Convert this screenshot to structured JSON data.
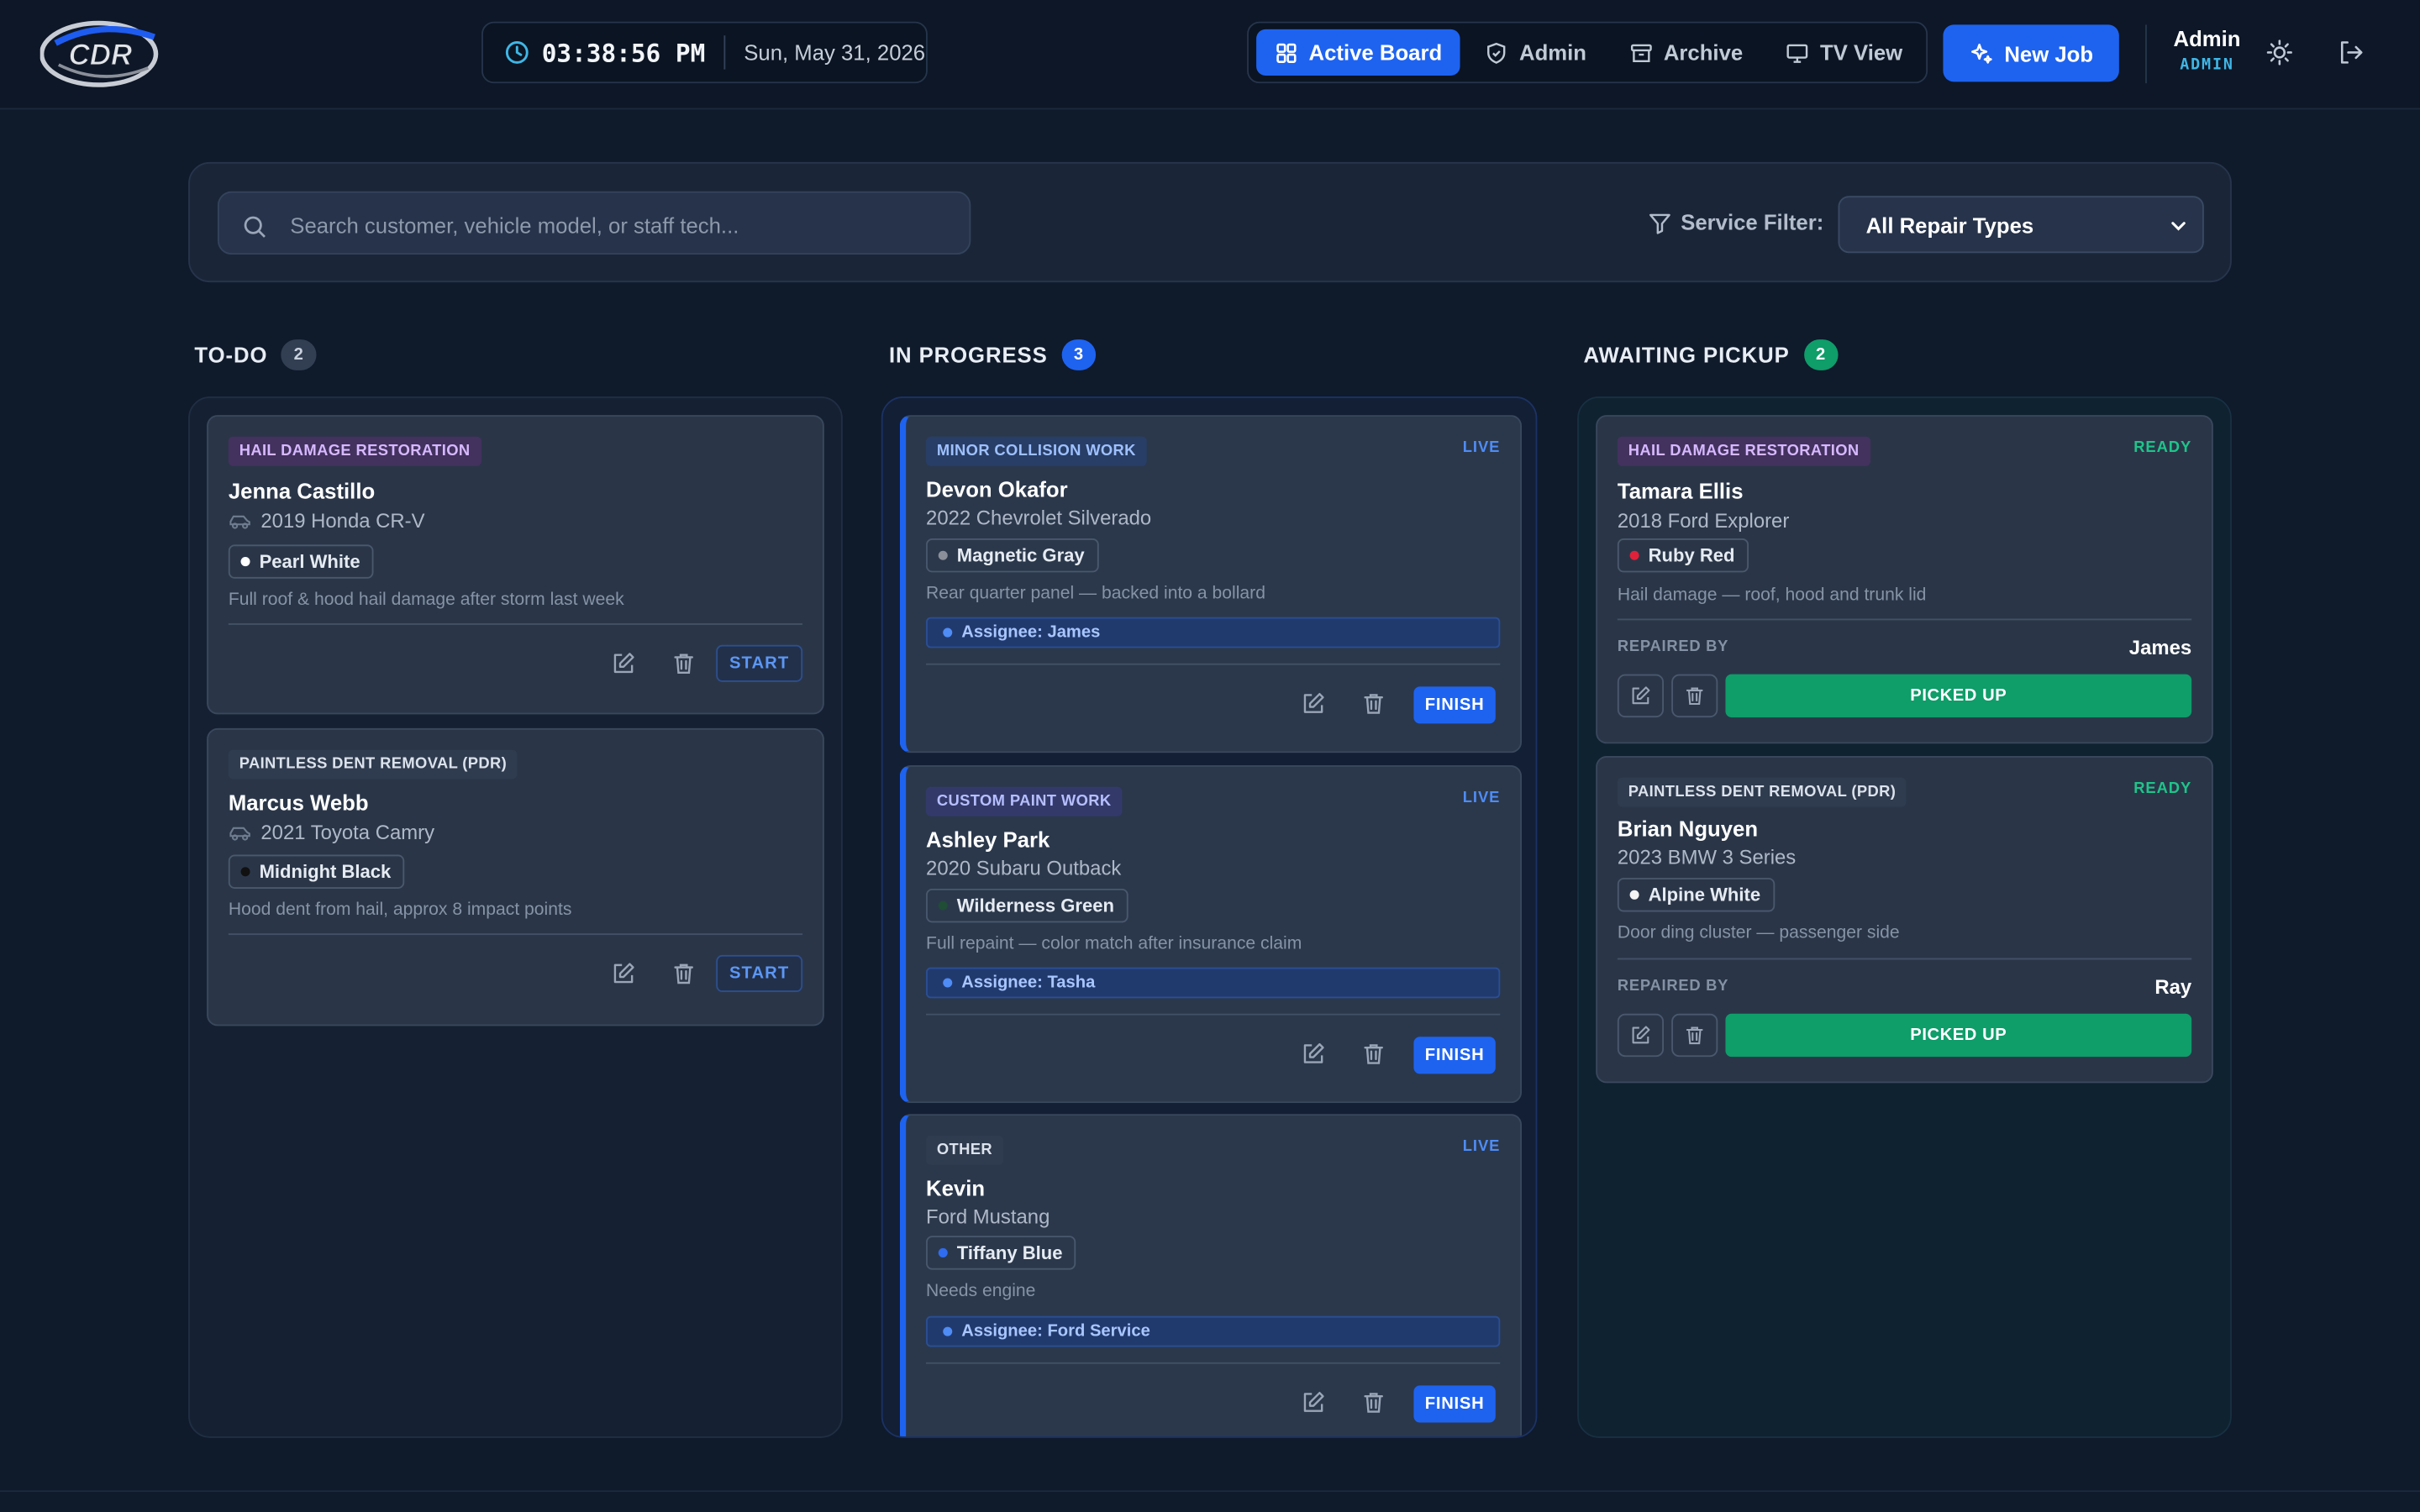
{
  "header": {
    "logo_text": "CDR",
    "time": "03:38:56 PM",
    "date": "Sun, May 31, 2026",
    "nav": [
      {
        "label": "Active Board",
        "icon": "grid-icon",
        "active": true
      },
      {
        "label": "Admin",
        "icon": "shield-icon",
        "active": false
      },
      {
        "label": "Archive",
        "icon": "archive-icon",
        "active": false
      },
      {
        "label": "TV View",
        "icon": "monitor-icon",
        "active": false
      }
    ],
    "new_job_label": "New Job",
    "user_name": "Admin",
    "user_role": "ADMIN"
  },
  "filter": {
    "search_placeholder": "Search customer, vehicle model, or staff tech...",
    "service_label": "Service Filter:",
    "service_selected": "All Repair Types"
  },
  "columns": {
    "todo": {
      "title": "TO-DO",
      "count": "2",
      "cards": [
        {
          "tag": "HAIL DAMAGE RESTORATION",
          "customer": "Jenna Castillo",
          "vehicle": "2019 Honda CR-V",
          "color": "Pearl White",
          "color_hex": "#ffffff",
          "note": "Full roof & hood hail damage after storm last week",
          "action": "START"
        },
        {
          "tag": "PAINTLESS DENT REMOVAL (PDR)",
          "customer": "Marcus Webb",
          "vehicle": "2021 Toyota Camry",
          "color": "Midnight Black",
          "color_hex": "#111111",
          "note": "Hood dent from hail, approx 8 impact points",
          "action": "START"
        }
      ]
    },
    "in_progress": {
      "title": "IN PROGRESS",
      "count": "3",
      "cards": [
        {
          "tag": "MINOR COLLISION WORK",
          "status": "LIVE",
          "customer": "Devon Okafor",
          "vehicle": "2022 Chevrolet Silverado",
          "color": "Magnetic Gray",
          "color_hex": "#8a8f99",
          "note": "Rear quarter panel — backed into a bollard",
          "assignee": "Assignee: James",
          "action": "FINISH"
        },
        {
          "tag": "CUSTOM PAINT WORK",
          "status": "LIVE",
          "customer": "Ashley Park",
          "vehicle": "2020 Subaru Outback",
          "color": "Wilderness Green",
          "color_hex": "#1f4d35",
          "note": "Full repaint — color match after insurance claim",
          "assignee": "Assignee: Tasha",
          "action": "FINISH"
        },
        {
          "tag": "OTHER",
          "status": "LIVE",
          "customer": "Kevin",
          "vehicle": "Ford Mustang",
          "color": "Tiffany Blue",
          "color_hex": "#2f6cf0",
          "note": "Needs engine",
          "assignee": "Assignee: Ford Service",
          "action": "FINISH"
        }
      ]
    },
    "pickup": {
      "title": "AWAITING PICKUP",
      "count": "2",
      "cards": [
        {
          "tag": "HAIL DAMAGE RESTORATION",
          "status": "READY",
          "customer": "Tamara Ellis",
          "vehicle": "2018 Ford Explorer",
          "color": "Ruby Red",
          "color_hex": "#e0213a",
          "note": "Hail damage — roof, hood and trunk lid",
          "repaired_label": "REPAIRED BY",
          "repaired_by": "James",
          "action": "PICKED UP"
        },
        {
          "tag": "PAINTLESS DENT REMOVAL (PDR)",
          "status": "READY",
          "customer": "Brian Nguyen",
          "vehicle": "2023 BMW 3 Series",
          "color": "Alpine White",
          "color_hex": "#f4f4f4",
          "note": "Door ding cluster — passenger side",
          "repaired_label": "REPAIRED BY",
          "repaired_by": "Ray",
          "action": "PICKED UP"
        }
      ]
    }
  },
  "colors": {
    "accent": "#1e63f0",
    "ready": "#0f9d6a",
    "background": "#0f1a2b"
  }
}
